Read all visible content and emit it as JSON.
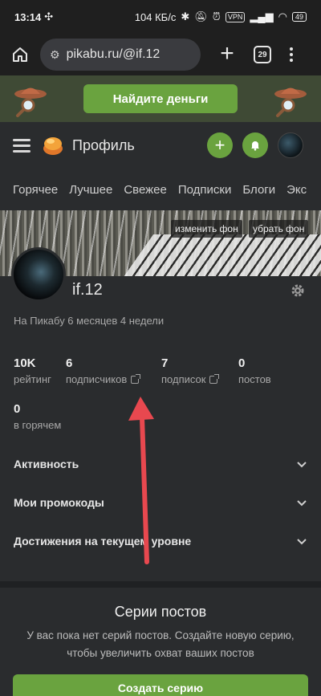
{
  "status_bar": {
    "time": "13:14",
    "speed": "104 КБ/с",
    "vpn": "VPN",
    "battery": "49"
  },
  "browser": {
    "url": "pikabu.ru/@if.12",
    "tab_count": "29"
  },
  "promo": {
    "button": "Найдите деньги"
  },
  "header": {
    "title": "Профиль"
  },
  "nav_tabs": [
    "Горячее",
    "Лучшее",
    "Свежее",
    "Подписки",
    "Блоги",
    "Экс"
  ],
  "cover": {
    "change_bg": "изменить фон",
    "remove_bg": "убрать фон"
  },
  "profile": {
    "username": "if.12",
    "since": "На Пикабу 6 месяцев 4 недели",
    "stats": [
      {
        "value": "10K",
        "label": "рейтинг"
      },
      {
        "value": "6",
        "label": "подписчиков"
      },
      {
        "value": "7",
        "label": "подписок"
      },
      {
        "value": "0",
        "label": "постов"
      },
      {
        "value": "0",
        "label": "в горячем"
      }
    ]
  },
  "accordions": [
    "Активность",
    "Мои промокоды",
    "Достижения на текущем уровне"
  ],
  "series": {
    "title": "Серии постов",
    "text": "У вас пока нет серий постов. Создайте новую серию, чтобы увеличить охват ваших постов",
    "button": "Создать серию"
  },
  "colors": {
    "accent": "#6aa33f",
    "background": "#1f2123",
    "panel": "#2a2c2e",
    "arrow": "#e8484f"
  }
}
